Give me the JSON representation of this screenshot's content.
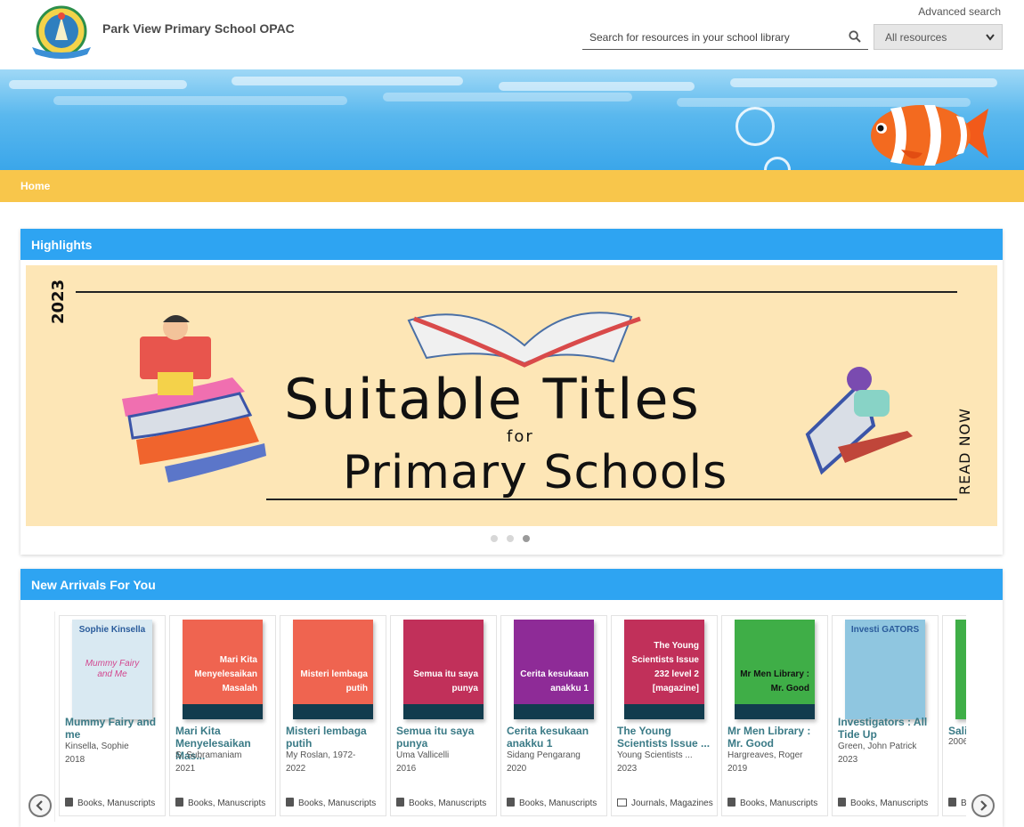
{
  "header": {
    "site_title": "Park View Primary School OPAC",
    "advanced_search": "Advanced search",
    "search_placeholder": "Search for resources in your school library",
    "resource_select": "All resources"
  },
  "nav": {
    "home": "Home"
  },
  "highlights": {
    "heading": "Highlights",
    "banner": {
      "year": "2023",
      "line1": "Suitable Titles",
      "line2": "for",
      "line3": "Primary Schools",
      "cta": "READ NOW"
    },
    "dots": 3,
    "active_dot": 3
  },
  "arrivals": {
    "heading": "New Arrivals For You",
    "items": [
      {
        "title": "Mummy Fairy and me",
        "author": "Kinsella, Sophie",
        "year": "2018",
        "type": "Books, Manuscripts",
        "cover_color": "#d9e9f2",
        "cover_text": "",
        "cover_brand": "Sophie Kinsella",
        "cover_sub": "Mummy Fairy and Me"
      },
      {
        "title": "Mari Kita Menyelesaikan Mas...",
        "author": "S. Subramaniam",
        "year": "2021",
        "type": "Books, Manuscripts",
        "cover_color": "#ef6450",
        "cover_text": "Mari Kita Menyelesaikan Masalah"
      },
      {
        "title": "Misteri lembaga putih",
        "author": "My Roslan, 1972-",
        "year": "2022",
        "type": "Books, Manuscripts",
        "cover_color": "#ef6450",
        "cover_text": "Misteri lembaga putih"
      },
      {
        "title": "Semua itu saya punya",
        "author": "Uma Vallicelli",
        "year": "2016",
        "type": "Books, Manuscripts",
        "cover_color": "#c1305a",
        "cover_text": "Semua itu saya punya"
      },
      {
        "title": "Cerita kesukaan anakku 1",
        "author": "Sidang Pengarang",
        "year": "2020",
        "type": "Books, Manuscripts",
        "cover_color": "#8e2b97",
        "cover_text": "Cerita kesukaan anakku 1"
      },
      {
        "title": "The Young Scientists Issue ...",
        "author": "Young Scientists ...",
        "year": "2023",
        "type": "Journals, Magazines",
        "cover_color": "#c1305a",
        "cover_text": "The Young Scientists Issue 232 level 2 [magazine]"
      },
      {
        "title": "Mr Men Library : Mr. Good",
        "author": "Hargreaves, Roger",
        "year": "2019",
        "type": "Books, Manuscripts",
        "cover_color": "#3fae47",
        "cover_text": "Mr Men Library : Mr. Good",
        "dark_text": true
      },
      {
        "title": "Investigators : All Tide Up",
        "author": "Green, John Patrick",
        "year": "2023",
        "type": "Books, Manuscripts",
        "cover_color": "#8fc6e0",
        "cover_text": "",
        "cover_brand": "Investi GATORS"
      },
      {
        "title": "Sali",
        "author": "",
        "year": "2006",
        "type": "B",
        "cover_color": "#3fae47",
        "cover_text": ""
      }
    ]
  }
}
